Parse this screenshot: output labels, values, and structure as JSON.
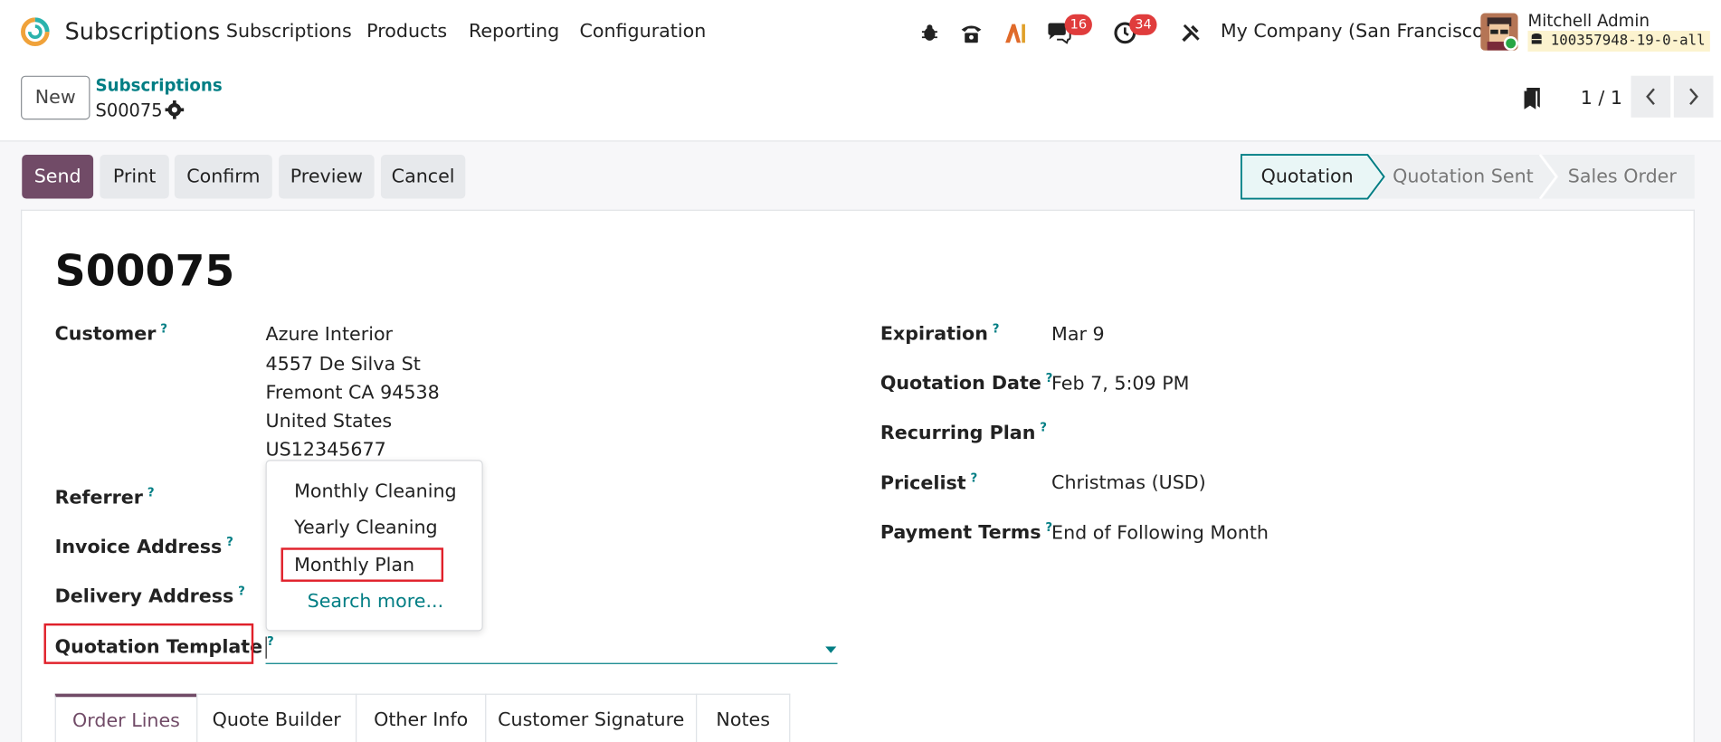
{
  "navbar": {
    "app_name": "Subscriptions",
    "menu": [
      "Subscriptions",
      "Products",
      "Reporting",
      "Configuration"
    ],
    "messages_badge": "16",
    "activities_badge": "34",
    "company": "My Company (San Francisco)",
    "user_name": "Mitchell Admin",
    "database": "100357948-19-0-all"
  },
  "control_panel": {
    "new_label": "New",
    "breadcrumb_parent": "Subscriptions",
    "breadcrumb_current": "S00075",
    "pager": "1 / 1"
  },
  "status_bar": {
    "buttons": [
      "Send",
      "Print",
      "Confirm",
      "Preview",
      "Cancel"
    ],
    "stages": [
      "Quotation",
      "Quotation Sent",
      "Sales Order"
    ],
    "active_stage": "Quotation"
  },
  "form": {
    "title": "S00075",
    "customer_label": "Customer",
    "customer_lines": [
      "Azure Interior",
      "4557 De Silva St",
      "Fremont CA 94538",
      "United States",
      "US12345677"
    ],
    "referrer_label": "Referrer",
    "invoice_address_label": "Invoice Address",
    "delivery_address_label": "Delivery Address",
    "quotation_template_label": "Quotation Template",
    "help_mark": "?",
    "expiration_label": "Expiration",
    "expiration_value": "Mar 9",
    "quotation_date_label": "Quotation Date",
    "quotation_date_value": "Feb 7, 5:09 PM",
    "recurring_plan_label": "Recurring Plan",
    "pricelist_label": "Pricelist",
    "pricelist_value": "Christmas (USD)",
    "payment_terms_label": "Payment Terms",
    "payment_terms_value": "End of Following Month"
  },
  "dropdown": {
    "options": [
      "Monthly Cleaning",
      "Yearly Cleaning",
      "Monthly Plan"
    ],
    "search_more": "Search more..."
  },
  "tabs": [
    "Order Lines",
    "Quote Builder",
    "Other Info",
    "Customer Signature",
    "Notes"
  ],
  "colors": {
    "primary": "#714b67",
    "link": "#017e84",
    "badge": "#e03c3c",
    "highlight": "#e0202a"
  }
}
